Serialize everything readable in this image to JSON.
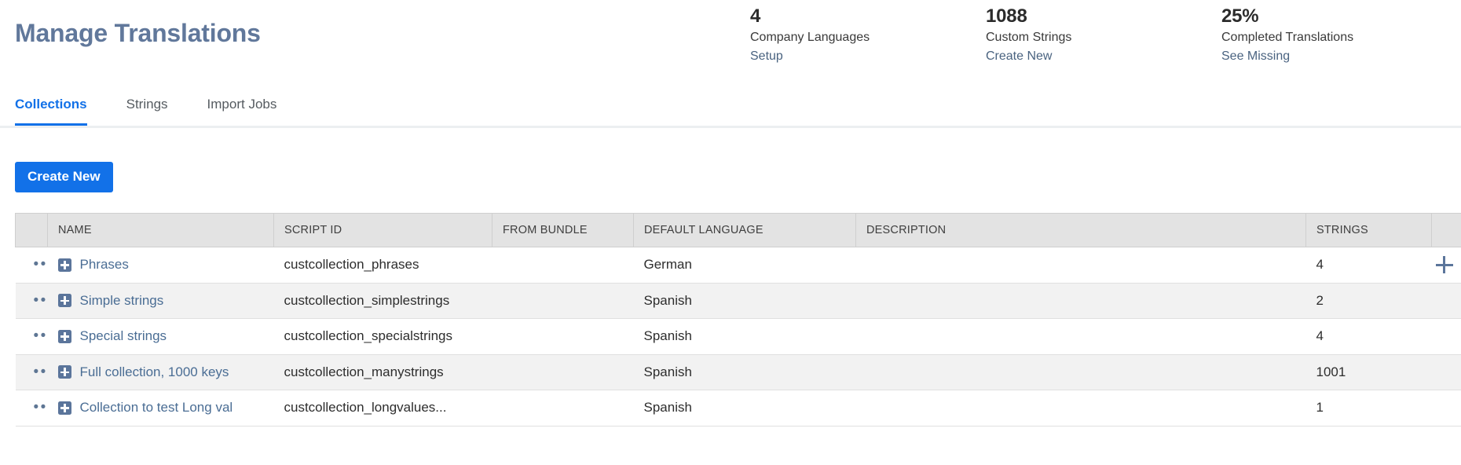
{
  "header": {
    "title": "Manage Translations",
    "stats": [
      {
        "value": "4",
        "label": "Company Languages",
        "link": "Setup"
      },
      {
        "value": "1088",
        "label": "Custom Strings",
        "link": "Create New"
      },
      {
        "value": "25%",
        "label": "Completed Translations",
        "link": "See Missing"
      }
    ]
  },
  "tabs": [
    {
      "label": "Collections",
      "active": true
    },
    {
      "label": "Strings",
      "active": false
    },
    {
      "label": "Import Jobs",
      "active": false
    }
  ],
  "toolbar": {
    "create_new_label": "Create New"
  },
  "table": {
    "columns": [
      {
        "key": "select",
        "label": ""
      },
      {
        "key": "name",
        "label": "NAME"
      },
      {
        "key": "script_id",
        "label": "SCRIPT ID"
      },
      {
        "key": "from_bundle",
        "label": "FROM BUNDLE"
      },
      {
        "key": "default_language",
        "label": "DEFAULT LANGUAGE"
      },
      {
        "key": "description",
        "label": "DESCRIPTION"
      },
      {
        "key": "strings",
        "label": "STRINGS"
      },
      {
        "key": "add",
        "label": ""
      }
    ],
    "row_menu_icon": "•••",
    "expand_icon": "plus-square-icon",
    "rows": [
      {
        "name": "Phrases",
        "script_id": "custcollection_phrases",
        "from_bundle": "",
        "default_language": "German",
        "description": "",
        "strings": "4",
        "has_add_icon": true
      },
      {
        "name": "Simple strings",
        "script_id": "custcollection_simplestrings",
        "from_bundle": "",
        "default_language": "Spanish",
        "description": "",
        "strings": "2",
        "has_add_icon": false
      },
      {
        "name": "Special strings",
        "script_id": "custcollection_specialstrings",
        "from_bundle": "",
        "default_language": "Spanish",
        "description": "",
        "strings": "4",
        "has_add_icon": false
      },
      {
        "name": "Full collection, 1000 keys",
        "script_id": "custcollection_manystrings",
        "from_bundle": "",
        "default_language": "Spanish",
        "description": "",
        "strings": "1001",
        "has_add_icon": false
      },
      {
        "name": "Collection to test Long val",
        "script_id": "custcollection_longvalues...",
        "from_bundle": "",
        "default_language": "Spanish",
        "description": "",
        "strings": "1",
        "has_add_icon": false
      }
    ]
  },
  "colors": {
    "title": "#61789b",
    "accent": "#1271e8",
    "link": "#4a6d94",
    "header_bg": "#e3e3e3",
    "row_alt_bg": "#f2f2f2",
    "icon_blue": "#5b759b"
  }
}
